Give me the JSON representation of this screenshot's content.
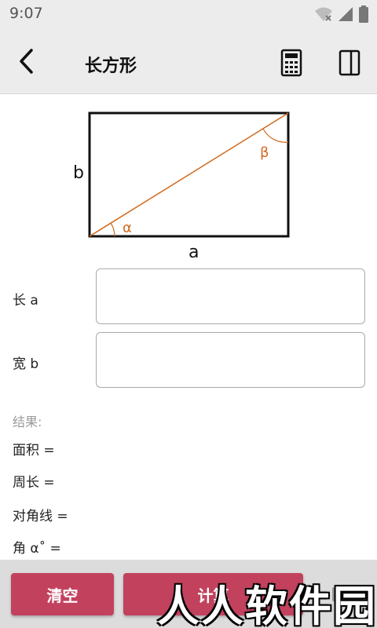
{
  "status_bar": {
    "time": "9:07"
  },
  "app_bar": {
    "title": "长方形"
  },
  "diagram": {
    "label_a": "a",
    "label_b": "b",
    "label_alpha": "α",
    "label_beta": "β"
  },
  "inputs": {
    "length": {
      "label": "长  a",
      "value": ""
    },
    "width": {
      "label": "宽  b",
      "value": ""
    }
  },
  "results": {
    "heading": "结果:",
    "area": "面积 =",
    "perimeter": "周长 =",
    "diagonal": "对角线 =",
    "angle": "角  α˚ ="
  },
  "buttons": {
    "clear": "清空",
    "calculate": "计算"
  },
  "watermark": "人人软件园",
  "colors": {
    "accent": "#c2425e",
    "diagram_accent": "#d2691e"
  }
}
